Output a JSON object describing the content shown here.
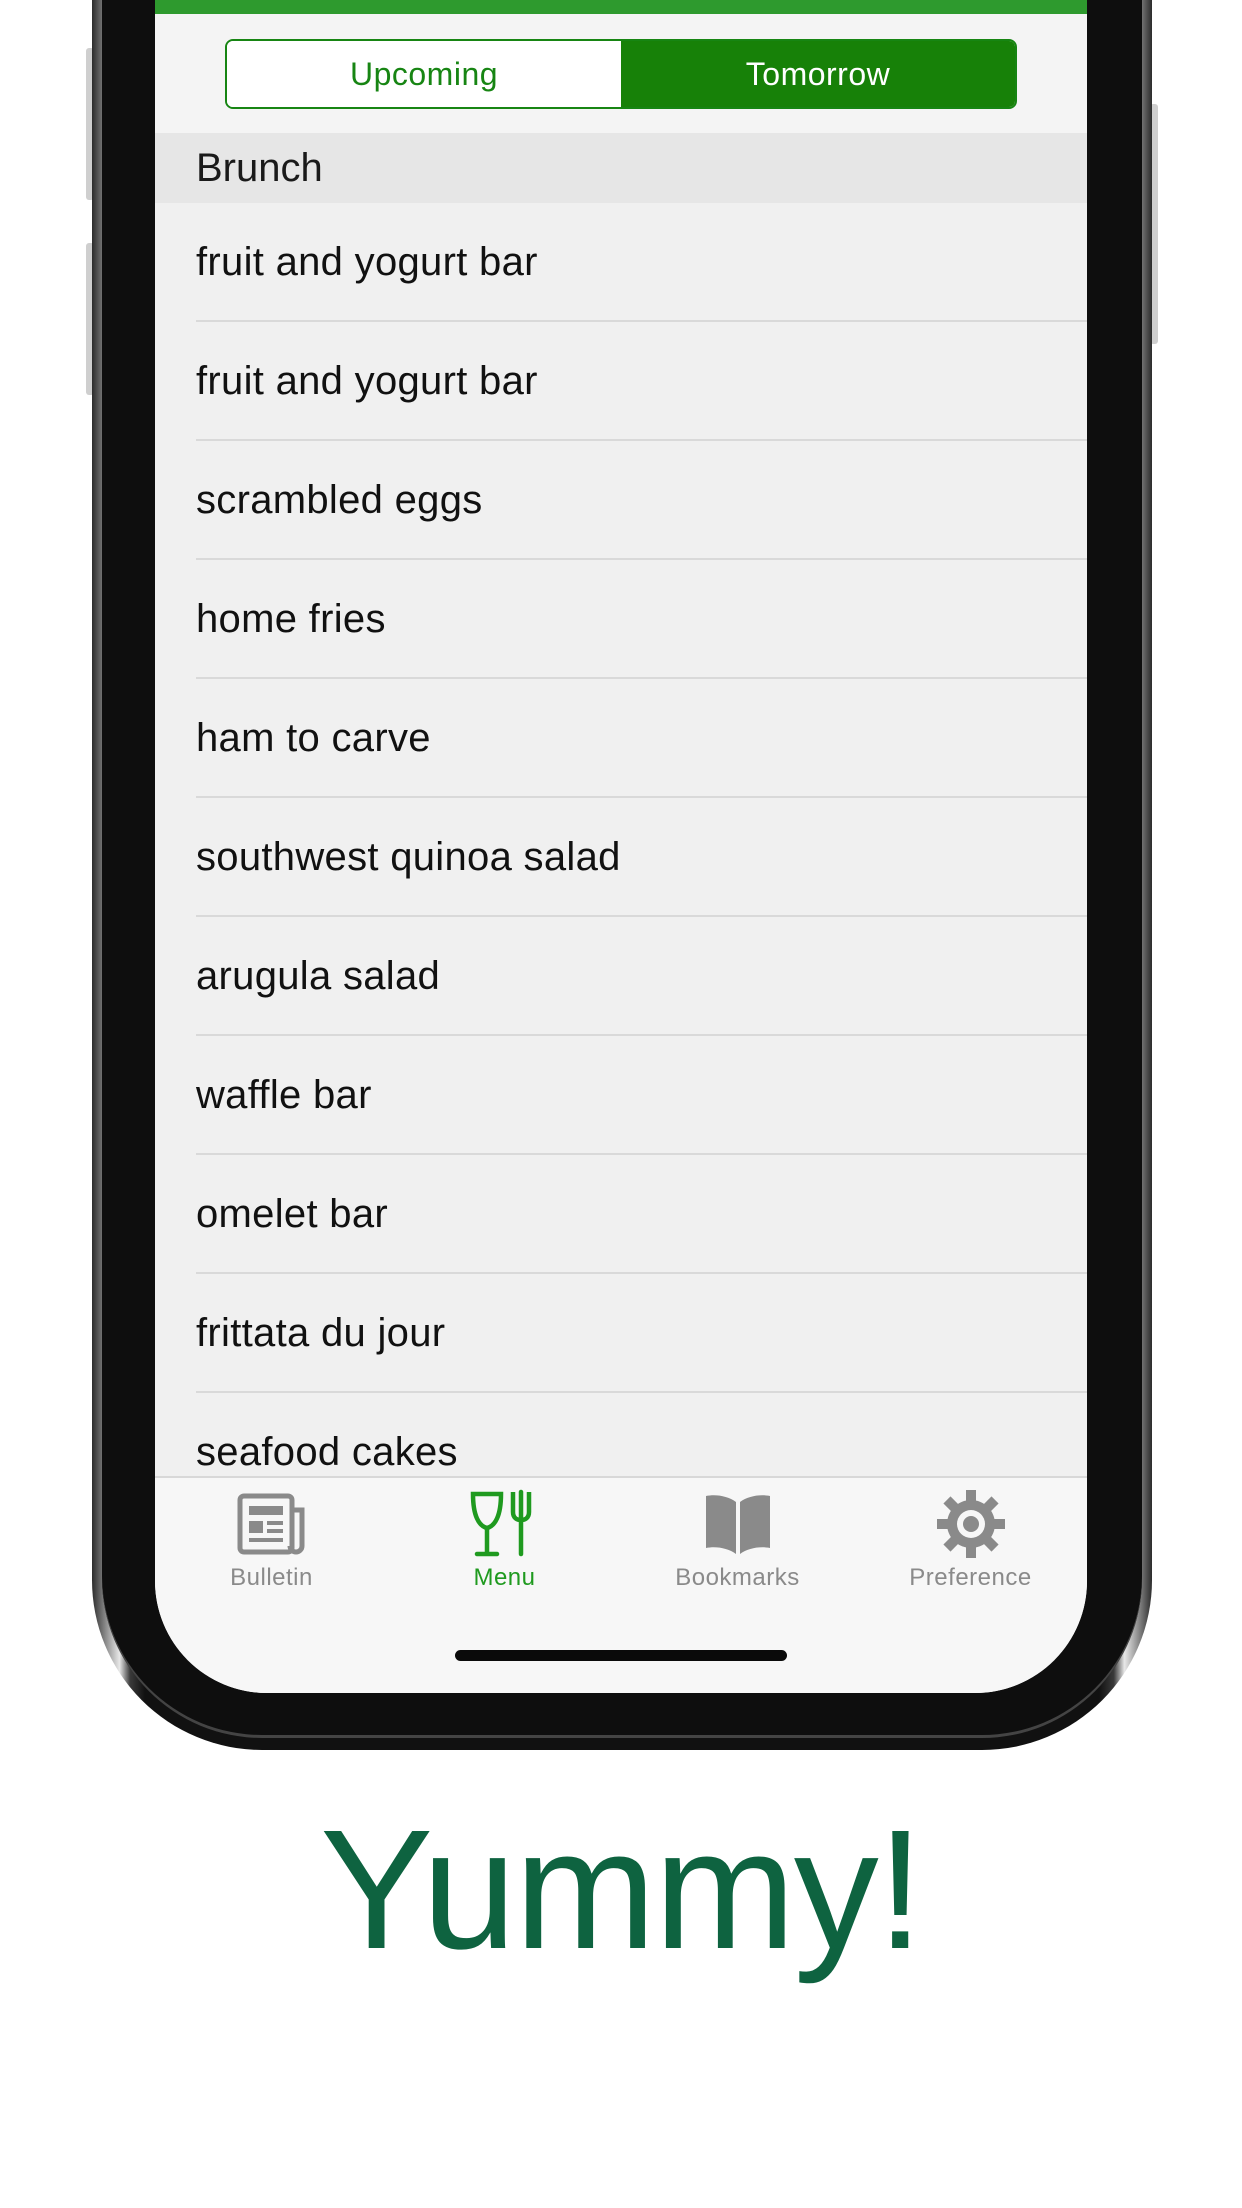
{
  "segmented": {
    "upcoming": "Upcoming",
    "tomorrow": "Tomorrow",
    "selected": "Tomorrow"
  },
  "section": {
    "title": "Brunch"
  },
  "menu_items": [
    "fruit and yogurt bar",
    "fruit and yogurt bar",
    "scrambled eggs",
    "home fries",
    "ham to carve",
    "southwest quinoa salad",
    "arugula salad",
    "waffle bar",
    "omelet bar",
    "frittata du jour",
    "seafood cakes"
  ],
  "tabs": [
    {
      "label": "Bulletin",
      "icon": "newspaper-icon"
    },
    {
      "label": "Menu",
      "icon": "glass-fork-icon"
    },
    {
      "label": "Bookmarks",
      "icon": "book-icon"
    },
    {
      "label": "Preference",
      "icon": "gear-icon"
    }
  ],
  "selected_tab": "Menu",
  "caption": "Yummy!",
  "colors": {
    "accent": "#178108",
    "caption": "#0e6340",
    "tab_active": "#1f9a1f",
    "tab_inactive": "#8a8a8a"
  }
}
